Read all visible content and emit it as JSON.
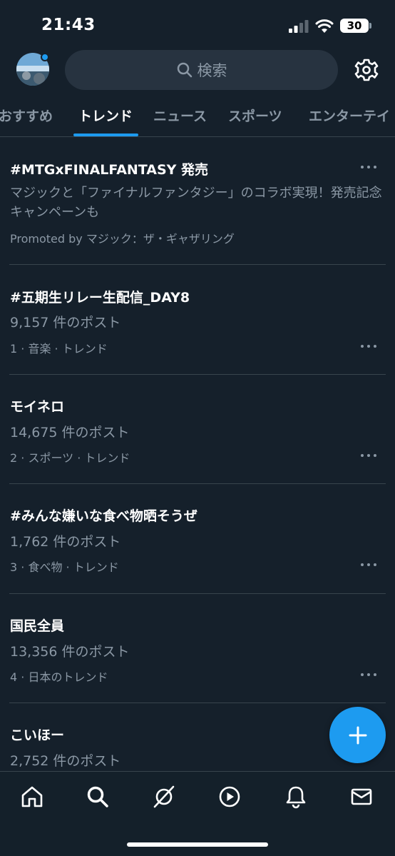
{
  "status_bar": {
    "time": "21:43",
    "battery": "30"
  },
  "header": {
    "search_placeholder": "検索"
  },
  "tabs": [
    {
      "label": "おすすめ",
      "active": false
    },
    {
      "label": "トレンド",
      "active": true
    },
    {
      "label": "ニュース",
      "active": false
    },
    {
      "label": "スポーツ",
      "active": false
    },
    {
      "label": "エンターテイ",
      "active": false
    }
  ],
  "trends": [
    {
      "title": "#MTGxFINALFANTASY 発売",
      "description": "マジックと「ファイナルファンタジー」のコラボ実現！発売記念キャンペーンも",
      "meta": "Promoted by マジック：ザ・ギャザリング"
    },
    {
      "title": "#五期生リレー生配信_DAY8",
      "posts": "9,157 件のポスト",
      "meta": "1 · 音楽 · トレンド"
    },
    {
      "title": "モイネロ",
      "posts": "14,675 件のポスト",
      "meta": "2 · スポーツ · トレンド"
    },
    {
      "title": "#みんな嫌いな食べ物晒そうぜ",
      "posts": "1,762 件のポスト",
      "meta": "3 · 食べ物 · トレンド"
    },
    {
      "title": "国民全員",
      "posts": "13,356 件のポスト",
      "meta": "4 · 日本のトレンド"
    },
    {
      "title": "こいほー",
      "posts": "2,752 件のポスト"
    }
  ],
  "icons": {
    "search": "search-icon",
    "settings": "gear-icon",
    "more": "more-dots-icon",
    "compose": "plus-icon",
    "home": "home-icon",
    "explore": "search-icon",
    "grok": "slash-circle-icon",
    "video": "play-icon",
    "notifications": "bell-icon",
    "messages": "mail-icon"
  },
  "colors": {
    "background": "#15202b",
    "accent": "#1d9bf0",
    "secondary_text": "#8b98a5",
    "divider": "#38444d"
  }
}
